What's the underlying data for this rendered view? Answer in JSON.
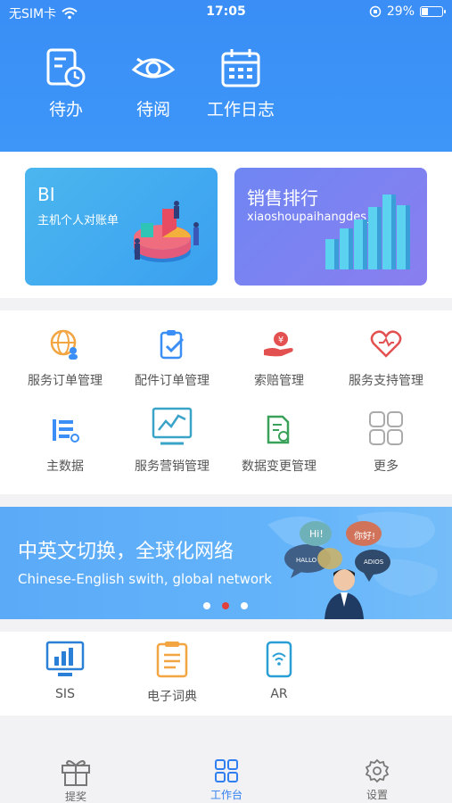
{
  "status_bar": {
    "carrier": "无SIM卡",
    "time": "17:05",
    "battery": "29%",
    "battery_level": 0.29
  },
  "quick_actions": [
    {
      "label": "待办",
      "icon": "todo-clock-icon"
    },
    {
      "label": "待阅",
      "icon": "eye-icon"
    },
    {
      "label": "工作日志",
      "icon": "calendar-icon"
    }
  ],
  "cards": [
    {
      "title": "BI",
      "subtitle": "主机个人对账单"
    },
    {
      "title": "销售排行",
      "subtitle": "xiaoshoupaihangdes_C"
    }
  ],
  "grid": [
    {
      "label": "服务订单管理",
      "icon": "globe-person-icon"
    },
    {
      "label": "配件订单管理",
      "icon": "clipboard-check-icon"
    },
    {
      "label": "索赔管理",
      "icon": "hand-money-icon"
    },
    {
      "label": "服务支持管理",
      "icon": "heart-icon"
    },
    {
      "label": "主数据",
      "icon": "list-gear-icon"
    },
    {
      "label": "服务营销管理",
      "icon": "chart-monitor-icon"
    },
    {
      "label": "数据变更管理",
      "icon": "document-refresh-icon"
    },
    {
      "label": "更多",
      "icon": "grid-more-icon"
    }
  ],
  "banner": {
    "title": "中英文切换，全球化网络",
    "subtitle": "Chinese-English swith, global network",
    "bubbles": [
      "Hi!",
      "你好!",
      "HALLO",
      "ADIOS"
    ],
    "active_dot": 1
  },
  "tools": [
    {
      "label": "SIS",
      "icon": "bar-chart-monitor-icon"
    },
    {
      "label": "电子词典",
      "icon": "notepad-icon"
    },
    {
      "label": "AR",
      "icon": "phone-wifi-icon"
    }
  ],
  "tabbar": [
    {
      "label": "提奖",
      "icon": "gift-icon"
    },
    {
      "label": "工作台",
      "icon": "grid-icon"
    },
    {
      "label": "设置",
      "icon": "gear-icon"
    }
  ],
  "colors": {
    "primary": "#3a8ef6",
    "active_dot": "#e0413a",
    "tab_active": "#2f7ff0"
  }
}
